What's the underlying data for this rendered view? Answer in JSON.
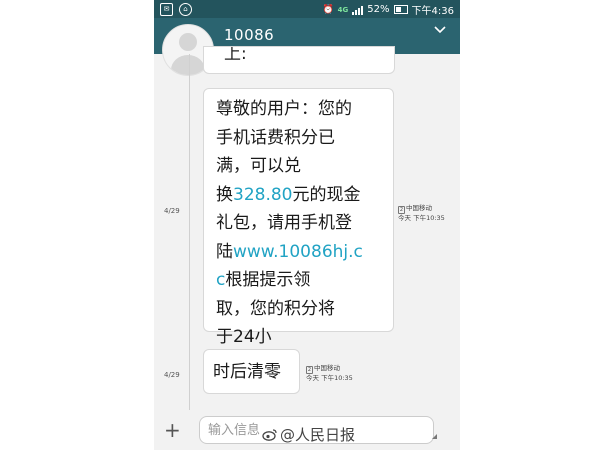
{
  "status_bar": {
    "network": "4G",
    "battery": "52%",
    "time": "下午4:36"
  },
  "header": {
    "contact": "10086"
  },
  "thread": {
    "previous_fragment": "上:",
    "messages": [
      {
        "date": "4/29",
        "lines": [
          [
            "尊敬的用户：您的"
          ],
          [
            "手机话费积分已"
          ],
          [
            "满，可以兑"
          ],
          [
            "换",
            {
              "link": "328.80"
            },
            "元的现金"
          ],
          [
            "礼包，请用手机登"
          ],
          [
            "陆",
            {
              "link": "www.10086hj.c"
            }
          ],
          [
            {
              "link": "c"
            },
            "根据提示领"
          ],
          [
            "取，您的积分将"
          ],
          [
            "于24小"
          ]
        ],
        "sim": "中国移动",
        "time": "今天 下午10:35"
      },
      {
        "date": "4/29",
        "text": "时后清零",
        "sim": "中国移动",
        "time": "今天 下午10:35"
      }
    ]
  },
  "input": {
    "placeholder": "输入信息"
  },
  "watermark": {
    "text": "@人民日报"
  },
  "colors": {
    "status_bar": "#23545d",
    "header": "#2b6470",
    "link": "#21a3c4"
  }
}
